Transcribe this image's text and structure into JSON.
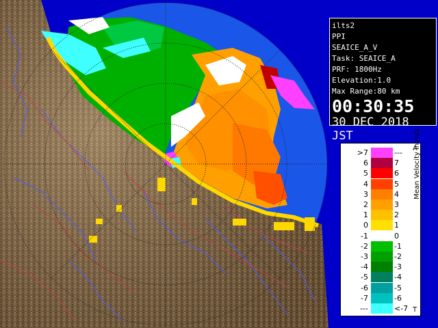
{
  "info_panel": {
    "site": "ilts2",
    "scan_type": "PPI",
    "product": "SEAICE_A_V",
    "task": "Task: SEAICE_A",
    "prf": "PRF: 1800Hz",
    "elevation": "Elevation:1.0",
    "max_range": "Max Range:80 km",
    "time": "00:30:35",
    "date": "30 DEC 2018 JST"
  },
  "legend": {
    "title": "Mean Velocity in m/s",
    "top_mark": "A",
    "bottom_mark": "T",
    "rows": [
      {
        "left": ">7",
        "right": "---",
        "color_left": "#ff40ff",
        "color_right": "#ff40ff"
      },
      {
        "left": "6",
        "right": "7",
        "color_left": "#b00040",
        "color_right": "#b00040"
      },
      {
        "left": "5",
        "right": "6",
        "color_left": "#ff0000",
        "color_right": "#ff0000"
      },
      {
        "left": "4",
        "right": "5",
        "color_left": "#ff4000",
        "color_right": "#ff4000"
      },
      {
        "left": "3",
        "right": "4",
        "color_left": "#ff8000",
        "color_right": "#ff8000"
      },
      {
        "left": "2",
        "right": "3",
        "color_left": "#ffa000",
        "color_right": "#ffa000"
      },
      {
        "left": "1",
        "right": "2",
        "color_left": "#ffc000",
        "color_right": "#ffc000"
      },
      {
        "left": "0",
        "right": "1",
        "color_left": "#ffe000",
        "color_right": "#ffe000"
      },
      {
        "left": "-1",
        "right": "0",
        "color_left": "#ffffff",
        "color_right": "#ffffff"
      },
      {
        "left": "-2",
        "right": "-1",
        "color_left": "#00c000",
        "color_right": "#00c000"
      },
      {
        "left": "-3",
        "right": "-2",
        "color_left": "#00a000",
        "color_right": "#00a000"
      },
      {
        "left": "-4",
        "right": "-3",
        "color_left": "#008000",
        "color_right": "#008000"
      },
      {
        "left": "-5",
        "right": "-4",
        "color_left": "#008060",
        "color_right": "#008060"
      },
      {
        "left": "-6",
        "right": "-5",
        "color_left": "#00a0a0",
        "color_right": "#00a0a0"
      },
      {
        "left": "-7",
        "right": "-6",
        "color_left": "#00c0c0",
        "color_right": "#00c0c0"
      },
      {
        "left": "---",
        "right": "<-7",
        "color_left": "#40ffff",
        "color_right": "#40ffff"
      }
    ]
  },
  "colors": {
    "sea": "#1a56e8",
    "outer_sea": "#0000c8",
    "land": "#8b6e4a",
    "coast": "#ffd800"
  }
}
